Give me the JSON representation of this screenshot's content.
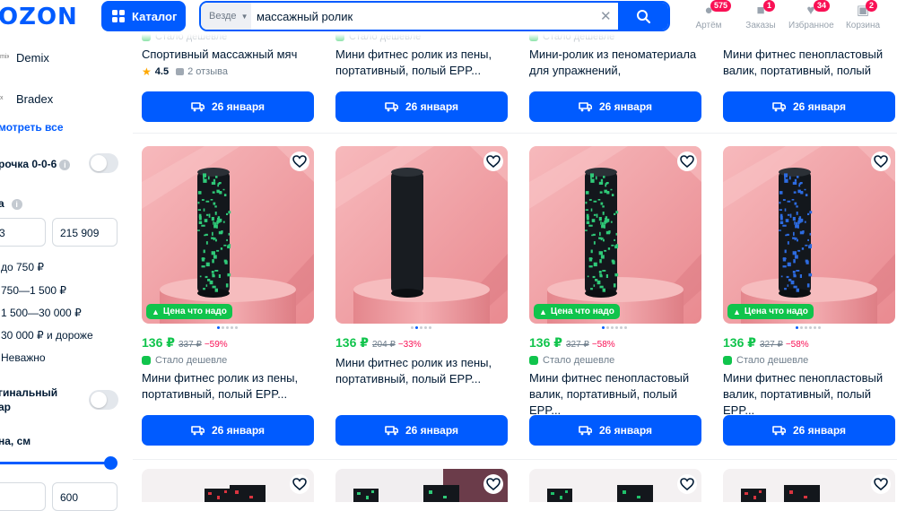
{
  "header": {
    "logo": "OZON",
    "catalog_label": "Каталог",
    "search_scope": "Везде",
    "search_query": "массажный ролик",
    "icons": [
      {
        "name": "profile-icon",
        "label": "Артём",
        "badge": "575"
      },
      {
        "name": "orders-icon",
        "label": "Заказы",
        "badge": "1"
      },
      {
        "name": "favorites-icon",
        "label": "Избранное",
        "badge": "34"
      },
      {
        "name": "cart-icon",
        "label": "Корзина",
        "badge": "2"
      }
    ]
  },
  "sidebar": {
    "brands": [
      "Demix",
      "Bradex"
    ],
    "brand_logo_text": [
      "mix",
      "x"
    ],
    "show_all": "мотреть все",
    "installment_label": "рочка 0-0-6",
    "price_label": "а",
    "price_from": "3",
    "price_to": "215 909",
    "price_options": [
      "до 750 ₽",
      "750—1 500 ₽",
      "1 500—30 000 ₽",
      "30 000 ₽ и дороже",
      "Неважно"
    ],
    "original_label_1": "гинальный",
    "original_label_2": "ар",
    "length_label": "на, см",
    "length_to": "600"
  },
  "top_row": [
    {
      "cheaper": "Стало дешевле",
      "title": "Спортивный массажный мяч",
      "rating": "4.5",
      "reviews": "2 отзыва",
      "delivery": "26 января"
    },
    {
      "cheaper": "Стало дешевле",
      "title": "Мини фитнес ролик из пены, портативный, полый EPP...",
      "delivery": "26 января"
    },
    {
      "cheaper": "Стало дешевле",
      "title": "Мини-ролик из пеноматериала для упражнений, портативный...",
      "delivery": "26 января"
    },
    {
      "title": "Мини фитнес пенопластовый валик, портативный, полый EPP...",
      "delivery": "26 января"
    }
  ],
  "main_row": [
    {
      "badge": "Цена что надо",
      "price": "136 ₽",
      "old_price": "337 ₽",
      "discount": "−59%",
      "cheaper": "Стало дешевле",
      "title": "Мини фитнес ролик из пены, портативный, полый EPP...",
      "delivery": "26 января",
      "dots": 5,
      "active_dot": 0,
      "roller_color": "#2fc978",
      "roller_base": "#13171c"
    },
    {
      "price": "136 ₽",
      "old_price": "204 ₽",
      "discount": "−33%",
      "title": "Мини фитнес ролик из пены, портативный, полый EPP...",
      "delivery": "26 января",
      "dots": 5,
      "active_dot": 1,
      "roller_color": "#252a31",
      "roller_base": "#181c21"
    },
    {
      "badge": "Цена что надо",
      "price": "136 ₽",
      "old_price": "327 ₽",
      "discount": "−58%",
      "cheaper": "Стало дешевле",
      "title": "Мини фитнес пенопластовый валик, портативный, полый EPP...",
      "delivery": "26 января",
      "dots": 6,
      "active_dot": 0,
      "roller_color": "#2fc978",
      "roller_base": "#13171c"
    },
    {
      "badge": "Цена что надо",
      "price": "136 ₽",
      "old_price": "327 ₽",
      "discount": "−58%",
      "cheaper": "Стало дешевле",
      "title": "Мини фитнес пенопластовый валик, портативный, полый EPP...",
      "delivery": "26 января",
      "dots": 6,
      "active_dot": 0,
      "roller_color": "#2d6be0",
      "roller_base": "#13171c"
    }
  ],
  "colors": {
    "brand": "#005bff",
    "sale": "#10c44c",
    "discount": "#f91155",
    "product_bg": "#f4a9ad"
  }
}
